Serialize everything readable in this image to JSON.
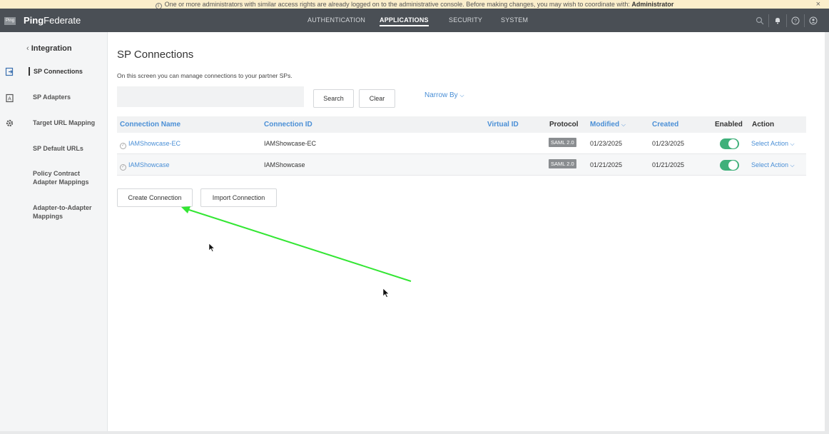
{
  "notice": {
    "text": "One or more administrators with similar access rights are already logged on to the administrative console. Before making changes, you may wish to coordinate with:",
    "admin": "Administrator",
    "close": "×"
  },
  "topbar": {
    "logo": "Ping",
    "brand_bold": "Ping",
    "brand_rest": "Federate",
    "nav": [
      "AUTHENTICATION",
      "APPLICATIONS",
      "SECURITY",
      "SYSTEM"
    ]
  },
  "sidebar": {
    "back": "Integration",
    "items": [
      "SP Connections",
      "SP Adapters",
      "Target URL Mapping",
      "SP Default URLs",
      "Policy Contract Adapter Mappings",
      "Adapter-to-Adapter Mappings"
    ]
  },
  "main": {
    "title": "SP Connections",
    "subtitle": "On this screen you can manage connections to your partner SPs.",
    "search_placeholder": "",
    "search_label": "Search",
    "clear_label": "Clear",
    "narrow_label": "Narrow By",
    "create_label": "Create Connection",
    "import_label": "Import Connection"
  },
  "table": {
    "headers": [
      "Connection Name",
      "Connection ID",
      "Virtual ID",
      "Protocol",
      "Modified",
      "Created",
      "Enabled",
      "Action"
    ],
    "rows": [
      {
        "name": "IAMShowcase-EC",
        "id": "IAMShowcase-EC",
        "protocol": "SAML 2.0",
        "modified": "01/23/2025",
        "created": "01/23/2025",
        "action": "Select Action"
      },
      {
        "name": "IAMShowcase",
        "id": "IAMShowcase",
        "protocol": "SAML 2.0",
        "modified": "01/21/2025",
        "created": "01/21/2025",
        "action": "Select Action"
      }
    ]
  },
  "colors": {
    "accent": "#4a8fd6",
    "topbar": "#4a4f55",
    "toggle_on": "#3fb07a",
    "annotation_arrow": "#33e633"
  }
}
